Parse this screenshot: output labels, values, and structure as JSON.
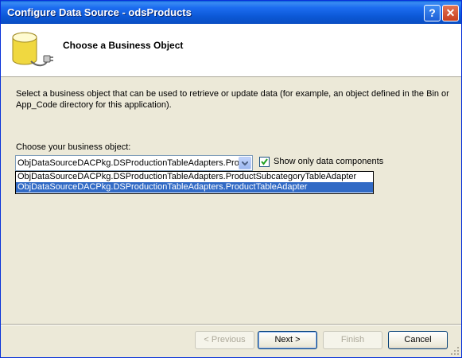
{
  "window": {
    "title": "Configure Data Source - odsProducts",
    "help_glyph": "?",
    "close_glyph": "✕"
  },
  "header": {
    "title": "Choose a Business Object",
    "icon": "database-icon"
  },
  "description": "Select a business object that can be used to retrieve or update data (for example, an object defined in the Bin or App_Code directory for this application).",
  "business_object": {
    "label": "Choose your business object:",
    "selected": "ObjDataSourceDACPkg.DSProductionTableAdapters.ProductTableAdapter",
    "options": [
      "ObjDataSourceDACPkg.DSProductionTableAdapters.ProductSubcategoryTableAdapter",
      "ObjDataSourceDACPkg.DSProductionTableAdapters.ProductTableAdapter"
    ],
    "highlighted_index": 1
  },
  "show_only_data_components": {
    "label": "Show only data components",
    "checked": true
  },
  "buttons": {
    "previous": "< Previous",
    "next": "Next >",
    "finish": "Finish",
    "cancel": "Cancel"
  }
}
